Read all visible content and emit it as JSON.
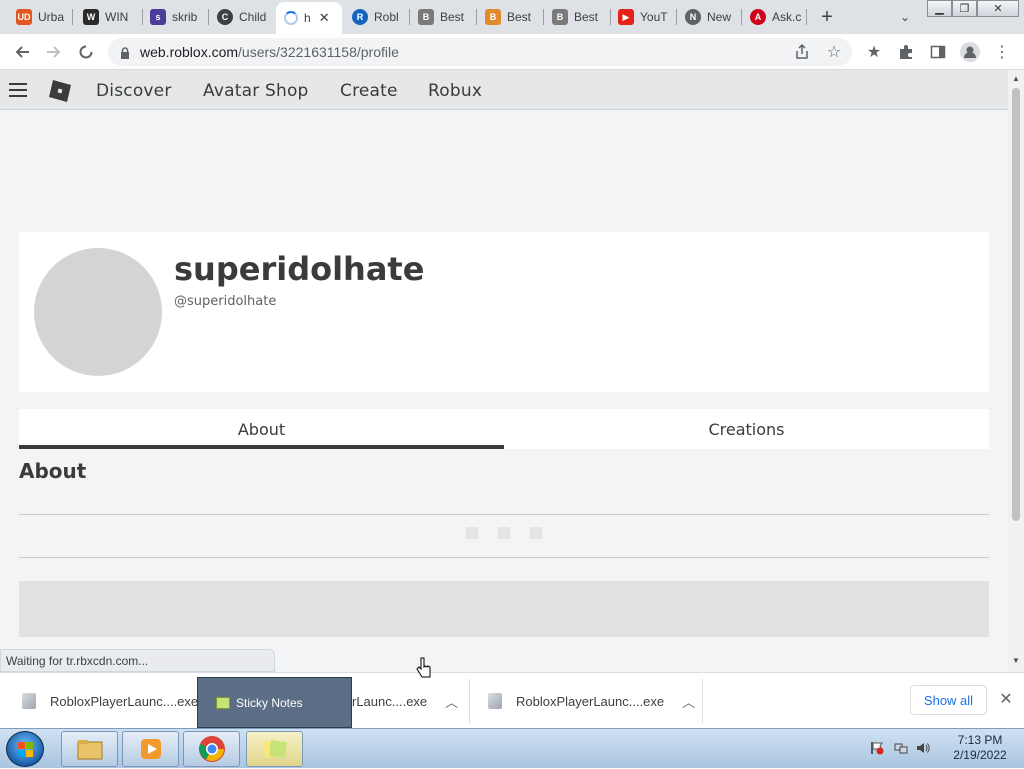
{
  "browser": {
    "tabs": [
      {
        "title": "Urba",
        "favicon": "UD",
        "color": "#e2561f"
      },
      {
        "title": "WIN",
        "favicon": "W",
        "color": "#2b2b2b"
      },
      {
        "title": "skrib",
        "favicon": "s",
        "color": "#4b3b9a"
      },
      {
        "title": "Child",
        "favicon": "C",
        "color": "#3c4043"
      },
      {
        "title": "h",
        "favicon": "",
        "color": "#1a73e8",
        "active": true
      },
      {
        "title": "Robl",
        "favicon": "R",
        "color": "#1565c0"
      },
      {
        "title": "Best",
        "favicon": "B",
        "color": "#7a7a7a"
      },
      {
        "title": "Best",
        "favicon": "B",
        "color": "#e08a2c"
      },
      {
        "title": "Best",
        "favicon": "B",
        "color": "#7a7a7a"
      },
      {
        "title": "YouT",
        "favicon": "▶",
        "color": "#e62117"
      },
      {
        "title": "New",
        "favicon": "N",
        "color": "#5f6368"
      },
      {
        "title": "Ask.c",
        "favicon": "A",
        "color": "#d0021b"
      }
    ],
    "url_host": "web.roblox.com",
    "url_path": "/users/3221631158/profile"
  },
  "roblox_nav": {
    "links": [
      "Discover",
      "Avatar Shop",
      "Create",
      "Robux"
    ]
  },
  "profile": {
    "display_name": "superidolhate",
    "username": "@superidolhate"
  },
  "profile_tabs": {
    "about": "About",
    "creations": "Creations"
  },
  "about_section": {
    "heading": "About"
  },
  "status_text": "Waiting for tr.rbxcdn.com...",
  "downloads": {
    "items": [
      {
        "name": "RobloxPlayerLaunc....exe"
      },
      {
        "name": "rLaunc....exe"
      },
      {
        "name": "RobloxPlayerLaunc....exe"
      }
    ],
    "show_all": "Show all"
  },
  "sticky_tooltip": "Sticky Notes",
  "taskbar": {
    "time": "7:13 PM",
    "date": "2/19/2022"
  }
}
